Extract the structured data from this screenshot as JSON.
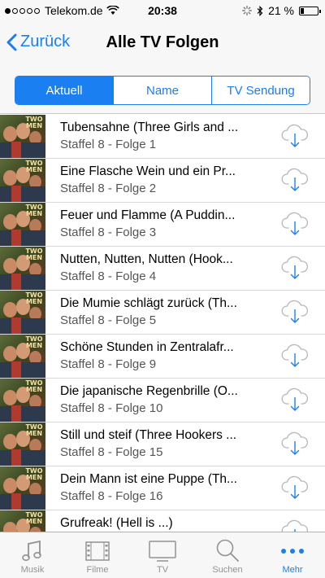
{
  "status_bar": {
    "carrier": "Telekom.de",
    "time": "20:38",
    "battery": "21 %",
    "battery_level": 0.21,
    "signal_bars": 1
  },
  "nav": {
    "back_label": "Zurück",
    "title": "Alle TV Folgen"
  },
  "segments": [
    {
      "label": "Aktuell",
      "active": true
    },
    {
      "label": "Name",
      "active": false
    },
    {
      "label": "TV Sendung",
      "active": false
    }
  ],
  "episodes": [
    {
      "title": "Tubensahne (Three Girls and ...",
      "subtitle": "Staffel 8 - Folge 1"
    },
    {
      "title": "Eine Flasche Wein und ein Pr...",
      "subtitle": "Staffel 8 - Folge 2"
    },
    {
      "title": "Feuer und Flamme (A Puddin...",
      "subtitle": "Staffel 8 - Folge 3"
    },
    {
      "title": "Nutten, Nutten, Nutten (Hook...",
      "subtitle": "Staffel 8 - Folge 4"
    },
    {
      "title": "Die Mumie schlägt zurück (Th...",
      "subtitle": "Staffel 8 - Folge 5"
    },
    {
      "title": "Schöne Stunden in Zentralafr...",
      "subtitle": "Staffel 8 - Folge 9"
    },
    {
      "title": "Die japanische Regenbrille (O...",
      "subtitle": "Staffel 8 - Folge 10"
    },
    {
      "title": "Still und steif (Three Hookers ...",
      "subtitle": "Staffel 8 - Folge 15"
    },
    {
      "title": "Dein Mann ist eine Puppe (Th...",
      "subtitle": "Staffel 8 - Folge 16"
    },
    {
      "title": "Grufreak! (Hell is ...)",
      "subtitle": ""
    }
  ],
  "thumbnail_logo": "TWO AND A HALF MEN",
  "tabs": [
    {
      "label": "Musik",
      "icon": "music-note-icon",
      "active": false
    },
    {
      "label": "Filme",
      "icon": "film-strip-icon",
      "active": false
    },
    {
      "label": "TV",
      "icon": "tv-icon",
      "active": false
    },
    {
      "label": "Suchen",
      "icon": "search-icon",
      "active": false
    },
    {
      "label": "Mehr",
      "icon": "more-dots-icon",
      "active": true
    }
  ],
  "colors": {
    "accent": "#1a7ff0",
    "inactive_tab": "#929292"
  }
}
